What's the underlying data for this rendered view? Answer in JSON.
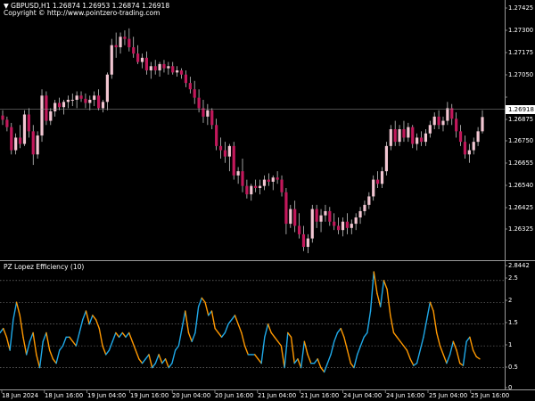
{
  "header": {
    "symbol": "GBPUSD,H1",
    "ohlc": "1.26874 1.26953 1.26874 1.26918",
    "copyright": "Copyright © http://www.pointzero-trading.com"
  },
  "price_axis": {
    "labels": [
      "1.27425",
      "1.27300",
      "1.27175",
      "1.27050",
      "1.26918",
      "1.26875",
      "1.26750",
      "1.26655",
      "1.26540",
      "1.26425",
      "1.26325"
    ],
    "current_price": "1.26918"
  },
  "indicator": {
    "title": "PZ Lopez Efficiency (10)",
    "axis_labels": [
      "2.8442",
      "2.5",
      "2",
      "1.5",
      "1",
      "0.5",
      "0"
    ]
  },
  "time_axis": {
    "labels": [
      "18 Jun 2024",
      "18 Jun 16:00",
      "19 Jun 04:00",
      "19 Jun 16:00",
      "20 Jun 04:00",
      "20 Jun 16:00",
      "21 Jun 04:00",
      "21 Jun 16:00",
      "24 Jun 04:00",
      "24 Jun 16:00",
      "25 Jun 04:00",
      "25 Jun 16:00"
    ]
  },
  "colors": {
    "background": "#000000",
    "bull_candle": "#f2c6d2",
    "bear_candle": "#c2185b",
    "wick": "#e0e0e0",
    "indicator_up": "#1fa9e8",
    "indicator_down": "#ff9800",
    "grid": "#8a8a8a",
    "separator": "#9a9a9a"
  },
  "chart_data": {
    "type": "candlestick",
    "symbol": "GBPUSD,H1",
    "candles": [
      [
        1.26925,
        1.2695,
        1.2688,
        1.26905
      ],
      [
        1.26905,
        1.2692,
        1.2685,
        1.2687
      ],
      [
        1.2687,
        1.2689,
        1.2674,
        1.2676
      ],
      [
        1.2676,
        1.2684,
        1.2674,
        1.2682
      ],
      [
        1.2682,
        1.2688,
        1.2677,
        1.2679
      ],
      [
        1.2679,
        1.2695,
        1.2678,
        1.2693
      ],
      [
        1.2693,
        1.2696,
        1.2682,
        1.2685
      ],
      [
        1.2685,
        1.2688,
        1.2669,
        1.2674
      ],
      [
        1.2674,
        1.2685,
        1.2672,
        1.2683
      ],
      [
        1.2683,
        1.2705,
        1.268,
        1.2702
      ],
      [
        1.2702,
        1.2704,
        1.2688,
        1.269
      ],
      [
        1.269,
        1.2696,
        1.2688,
        1.26945
      ],
      [
        1.26945,
        1.27,
        1.2692,
        1.26985
      ],
      [
        1.26985,
        1.2701,
        1.2695,
        1.26965
      ],
      [
        1.26965,
        1.27,
        1.2693,
        1.2699
      ],
      [
        1.2699,
        1.2702,
        1.2696,
        1.27
      ],
      [
        1.27,
        1.2703,
        1.2697,
        1.27
      ],
      [
        1.27,
        1.2704,
        1.2696,
        1.2702
      ],
      [
        1.2702,
        1.2704,
        1.2699,
        1.27005
      ],
      [
        1.27005,
        1.2703,
        1.2696,
        1.26985
      ],
      [
        1.26985,
        1.2702,
        1.2695,
        1.27
      ],
      [
        1.27,
        1.2704,
        1.2697,
        1.2702
      ],
      [
        1.2702,
        1.2705,
        1.2695,
        1.2696
      ],
      [
        1.2696,
        1.27,
        1.2694,
        1.2699
      ],
      [
        1.2699,
        1.2713,
        1.2695,
        1.2712
      ],
      [
        1.2712,
        1.2729,
        1.271,
        1.2726
      ],
      [
        1.2726,
        1.2732,
        1.272,
        1.2725
      ],
      [
        1.2725,
        1.2732,
        1.2722,
        1.273
      ],
      [
        1.273,
        1.2733,
        1.2726,
        1.2729
      ],
      [
        1.2729,
        1.2734,
        1.2723,
        1.2725
      ],
      [
        1.2725,
        1.273,
        1.272,
        1.2722
      ],
      [
        1.2722,
        1.2726,
        1.2717,
        1.2718
      ],
      [
        1.2718,
        1.2722,
        1.2715,
        1.272
      ],
      [
        1.272,
        1.2723,
        1.2712,
        1.2714
      ],
      [
        1.2714,
        1.2718,
        1.271,
        1.2716
      ],
      [
        1.2716,
        1.2719,
        1.2712,
        1.2714
      ],
      [
        1.2714,
        1.2718,
        1.2711,
        1.2717
      ],
      [
        1.2717,
        1.2719,
        1.2713,
        1.2715
      ],
      [
        1.2715,
        1.2718,
        1.2712,
        1.2716
      ],
      [
        1.2716,
        1.2718,
        1.2712,
        1.2713
      ],
      [
        1.2713,
        1.2716,
        1.2711,
        1.2714
      ],
      [
        1.2714,
        1.2715,
        1.271,
        1.2712
      ],
      [
        1.2712,
        1.2714,
        1.2706,
        1.2708
      ],
      [
        1.2708,
        1.2711,
        1.2703,
        1.2705
      ],
      [
        1.2705,
        1.2709,
        1.2698,
        1.2701
      ],
      [
        1.2701,
        1.2705,
        1.2694,
        1.2696
      ],
      [
        1.2696,
        1.27,
        1.2689,
        1.2692
      ],
      [
        1.2692,
        1.2698,
        1.2688,
        1.2695
      ],
      [
        1.2695,
        1.2696,
        1.2686,
        1.2688
      ],
      [
        1.2688,
        1.2691,
        1.2676,
        1.2678
      ],
      [
        1.2678,
        1.2682,
        1.2672,
        1.2676
      ],
      [
        1.2676,
        1.268,
        1.267,
        1.2673
      ],
      [
        1.2673,
        1.2679,
        1.2666,
        1.2678
      ],
      [
        1.2678,
        1.268,
        1.2662,
        1.2664
      ],
      [
        1.2664,
        1.2668,
        1.266,
        1.2666
      ],
      [
        1.2666,
        1.2672,
        1.2656,
        1.2659
      ],
      [
        1.2659,
        1.2662,
        1.2653,
        1.2655
      ],
      [
        1.2655,
        1.266,
        1.2652,
        1.2659
      ],
      [
        1.2659,
        1.2662,
        1.2656,
        1.2658
      ],
      [
        1.2658,
        1.2662,
        1.2655,
        1.2659
      ],
      [
        1.2659,
        1.2664,
        1.2657,
        1.2662
      ],
      [
        1.2662,
        1.2665,
        1.2659,
        1.2661
      ],
      [
        1.2661,
        1.2664,
        1.2657,
        1.2663
      ],
      [
        1.2663,
        1.2666,
        1.266,
        1.2662
      ],
      [
        1.2662,
        1.2664,
        1.2654,
        1.2656
      ],
      [
        1.2656,
        1.2658,
        1.2636,
        1.2641
      ],
      [
        1.2641,
        1.265,
        1.2639,
        1.2648
      ],
      [
        1.2648,
        1.2652,
        1.2637,
        1.264
      ],
      [
        1.264,
        1.2646,
        1.2634,
        1.2636
      ],
      [
        1.2636,
        1.264,
        1.2628,
        1.263
      ],
      [
        1.263,
        1.2636,
        1.2627,
        1.2634
      ],
      [
        1.2634,
        1.265,
        1.2632,
        1.2648
      ],
      [
        1.2648,
        1.265,
        1.2639,
        1.2642
      ],
      [
        1.2642,
        1.2648,
        1.2637,
        1.2645
      ],
      [
        1.2645,
        1.265,
        1.2642,
        1.2647
      ],
      [
        1.2647,
        1.2649,
        1.264,
        1.2642
      ],
      [
        1.2642,
        1.2646,
        1.2638,
        1.264
      ],
      [
        1.264,
        1.2644,
        1.2636,
        1.2638
      ],
      [
        1.2638,
        1.2644,
        1.2635,
        1.2642
      ],
      [
        1.2642,
        1.2646,
        1.2636,
        1.2639
      ],
      [
        1.2639,
        1.2643,
        1.2636,
        1.2641
      ],
      [
        1.2641,
        1.2646,
        1.2638,
        1.2644
      ],
      [
        1.2644,
        1.2649,
        1.2641,
        1.2647
      ],
      [
        1.2647,
        1.2652,
        1.2645,
        1.265
      ],
      [
        1.265,
        1.2656,
        1.2648,
        1.2654
      ],
      [
        1.2654,
        1.2664,
        1.2652,
        1.2662
      ],
      [
        1.2662,
        1.2666,
        1.2658,
        1.266
      ],
      [
        1.266,
        1.2668,
        1.2658,
        1.2666
      ],
      [
        1.2666,
        1.268,
        1.2664,
        1.2678
      ],
      [
        1.2678,
        1.2688,
        1.2676,
        1.2686
      ],
      [
        1.2686,
        1.269,
        1.2678,
        1.268
      ],
      [
        1.268,
        1.2688,
        1.2678,
        1.2686
      ],
      [
        1.2686,
        1.269,
        1.268,
        1.2682
      ],
      [
        1.2682,
        1.2689,
        1.268,
        1.2687
      ],
      [
        1.2687,
        1.2688,
        1.2677,
        1.2679
      ],
      [
        1.2679,
        1.2684,
        1.2676,
        1.2682
      ],
      [
        1.2682,
        1.2685,
        1.2678,
        1.268
      ],
      [
        1.268,
        1.2686,
        1.2678,
        1.2684
      ],
      [
        1.2684,
        1.269,
        1.2682,
        1.2688
      ],
      [
        1.2688,
        1.2694,
        1.2686,
        1.2692
      ],
      [
        1.2692,
        1.2695,
        1.2686,
        1.2688
      ],
      [
        1.2688,
        1.2692,
        1.2685,
        1.269
      ],
      [
        1.269,
        1.2699,
        1.2688,
        1.2696
      ],
      [
        1.2696,
        1.2698,
        1.2688,
        1.2691
      ],
      [
        1.2691,
        1.2694,
        1.2682,
        1.2685
      ],
      [
        1.2685,
        1.2688,
        1.2678,
        1.268
      ],
      [
        1.268,
        1.2683,
        1.2672,
        1.2674
      ],
      [
        1.2674,
        1.2679,
        1.267,
        1.2676
      ],
      [
        1.2676,
        1.2682,
        1.2674,
        1.268
      ],
      [
        1.268,
        1.2687,
        1.2678,
        1.2685
      ],
      [
        1.2685,
        1.2695,
        1.2684,
        1.26918
      ]
    ],
    "indicator": {
      "name": "PZ Lopez Efficiency (10)",
      "ylim": [
        0,
        2.8442
      ],
      "levels": [
        0.5,
        1,
        1.5,
        2,
        2.5
      ],
      "values": [
        1.3,
        1.4,
        1.2,
        0.9,
        1.6,
        2.0,
        1.7,
        1.2,
        0.8,
        1.1,
        1.3,
        0.8,
        0.5,
        1.1,
        1.3,
        0.9,
        0.7,
        0.6,
        0.9,
        1.0,
        1.2,
        1.2,
        1.1,
        1.0,
        1.3,
        1.6,
        1.8,
        1.5,
        1.7,
        1.6,
        1.4,
        1.0,
        0.8,
        0.9,
        1.1,
        1.3,
        1.2,
        1.3,
        1.2,
        1.3,
        1.1,
        0.9,
        0.7,
        0.6,
        0.7,
        0.8,
        0.5,
        0.6,
        0.8,
        0.6,
        0.7,
        0.5,
        0.6,
        0.9,
        1.0,
        1.4,
        1.8,
        1.3,
        1.1,
        1.3,
        1.9,
        2.1,
        2.0,
        1.7,
        1.8,
        1.4,
        1.3,
        1.2,
        1.3,
        1.5,
        1.6,
        1.7,
        1.5,
        1.3,
        1.0,
        0.8,
        0.8,
        0.8,
        0.7,
        0.6,
        1.2,
        1.5,
        1.3,
        1.2,
        1.1,
        1.0,
        0.5,
        1.3,
        1.2,
        0.6,
        0.7,
        0.5,
        1.1,
        0.8,
        0.6,
        0.6,
        0.7,
        0.5,
        0.4,
        0.6,
        0.8,
        1.1,
        1.3,
        1.4,
        1.2,
        0.9,
        0.6,
        0.5,
        0.8,
        1.0,
        1.2
      ]
    },
    "indicator_tail": [
      1.3,
      1.8,
      2.7,
      2.2,
      1.9,
      2.5,
      2.3,
      1.7,
      1.3,
      1.2,
      1.1,
      1.0,
      0.9,
      0.7,
      0.55,
      0.6,
      0.9,
      1.2,
      1.6,
      2.0,
      1.8,
      1.3,
      1.0,
      0.8,
      0.6,
      0.8,
      1.1,
      0.9,
      0.6,
      0.55,
      1.1,
      1.2,
      0.9,
      0.75,
      0.7
    ]
  }
}
